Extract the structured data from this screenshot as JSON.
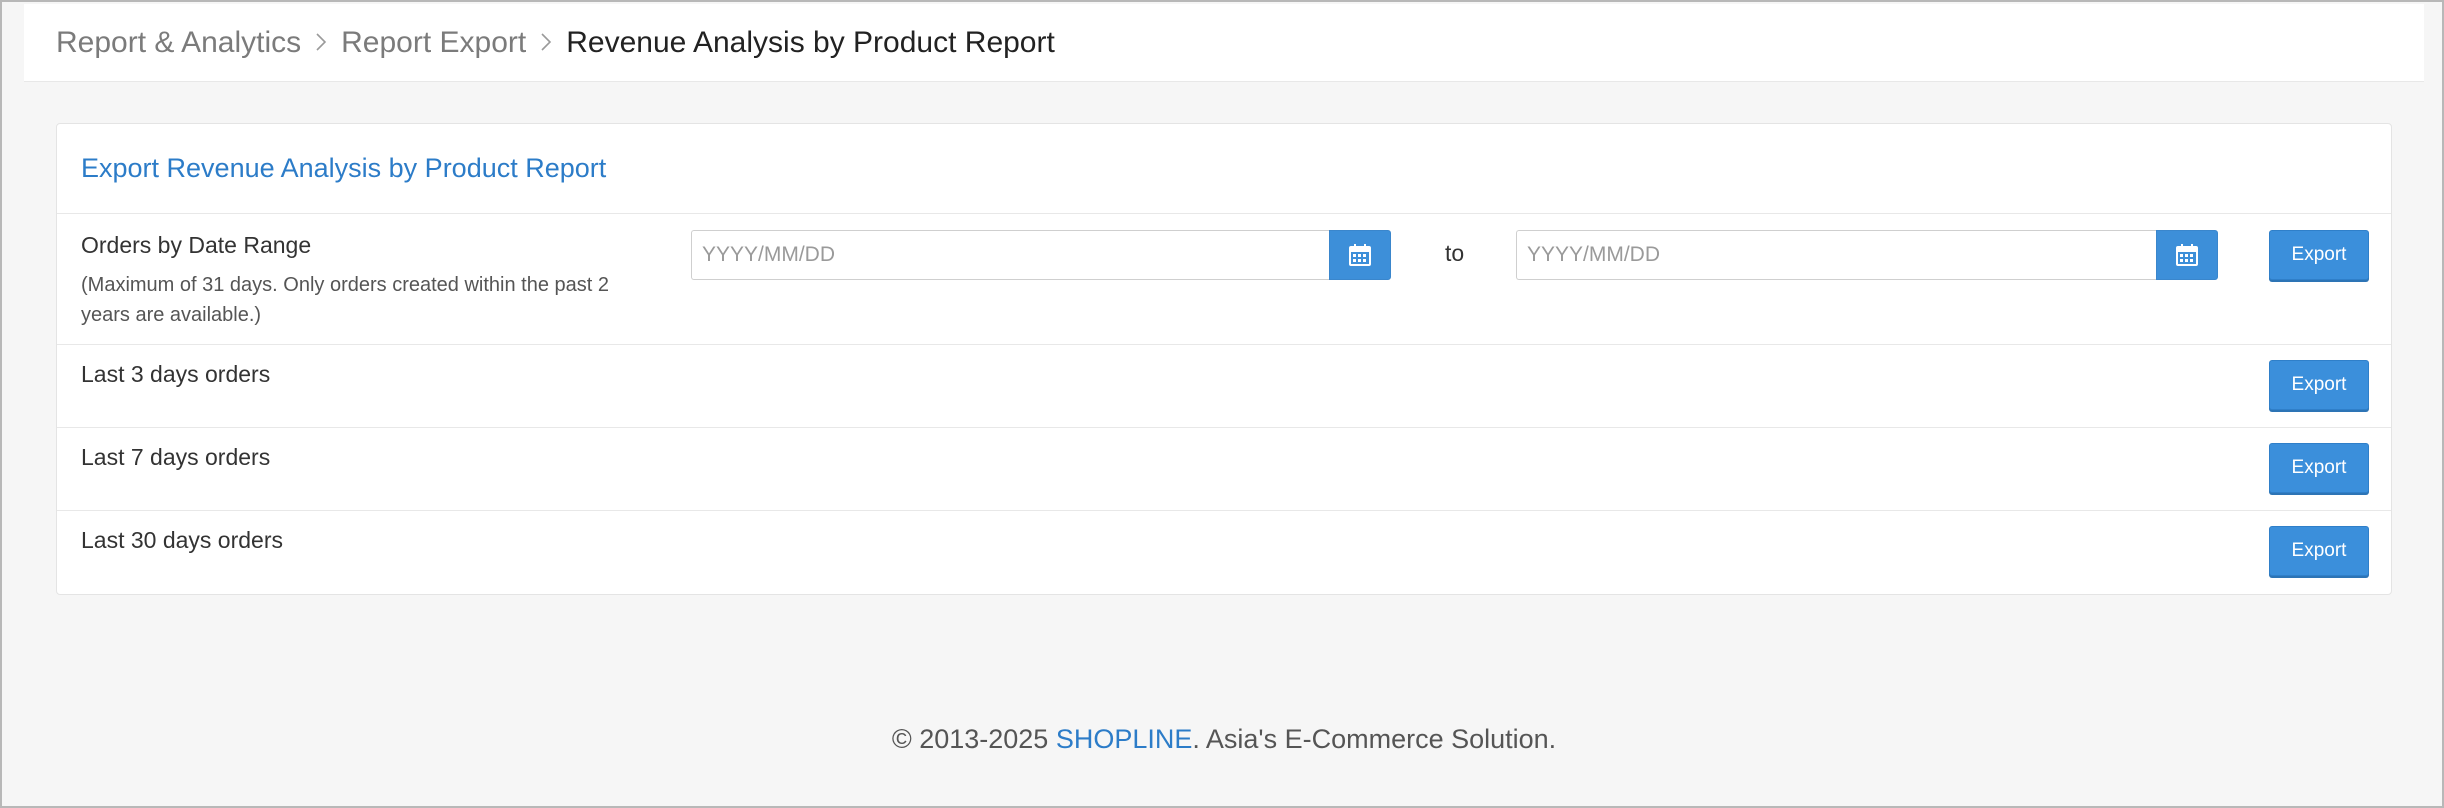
{
  "breadcrumb": {
    "items": [
      "Report & Analytics",
      "Report Export",
      "Revenue Analysis by Product Report"
    ],
    "separator": ">"
  },
  "panel": {
    "title": "Export Revenue Analysis by Product Report",
    "date_range": {
      "label": "Orders by Date Range",
      "note": "(Maximum of 31 days. Only orders created within the past 2 years are available.)",
      "from_placeholder": "YYYY/MM/DD",
      "from_value": "",
      "to_label": "to",
      "to_placeholder": "YYYY/MM/DD",
      "to_value": "",
      "export_label": "Export"
    },
    "rows": [
      {
        "label": "Last 3 days orders",
        "export_label": "Export"
      },
      {
        "label": "Last 7 days orders",
        "export_label": "Export"
      },
      {
        "label": "Last 30 days orders",
        "export_label": "Export"
      }
    ]
  },
  "footer": {
    "prefix": "© 2013-2025 ",
    "brand": "SHOPLINE",
    "suffix": ". Asia's E-Commerce Solution."
  },
  "icons": {
    "calendar": "calendar-icon",
    "breadcrumb_separator": "chevron-right-icon"
  },
  "colors": {
    "accent": "#3b8fdb",
    "title": "#2c7cc8",
    "background": "#f6f6f6"
  }
}
